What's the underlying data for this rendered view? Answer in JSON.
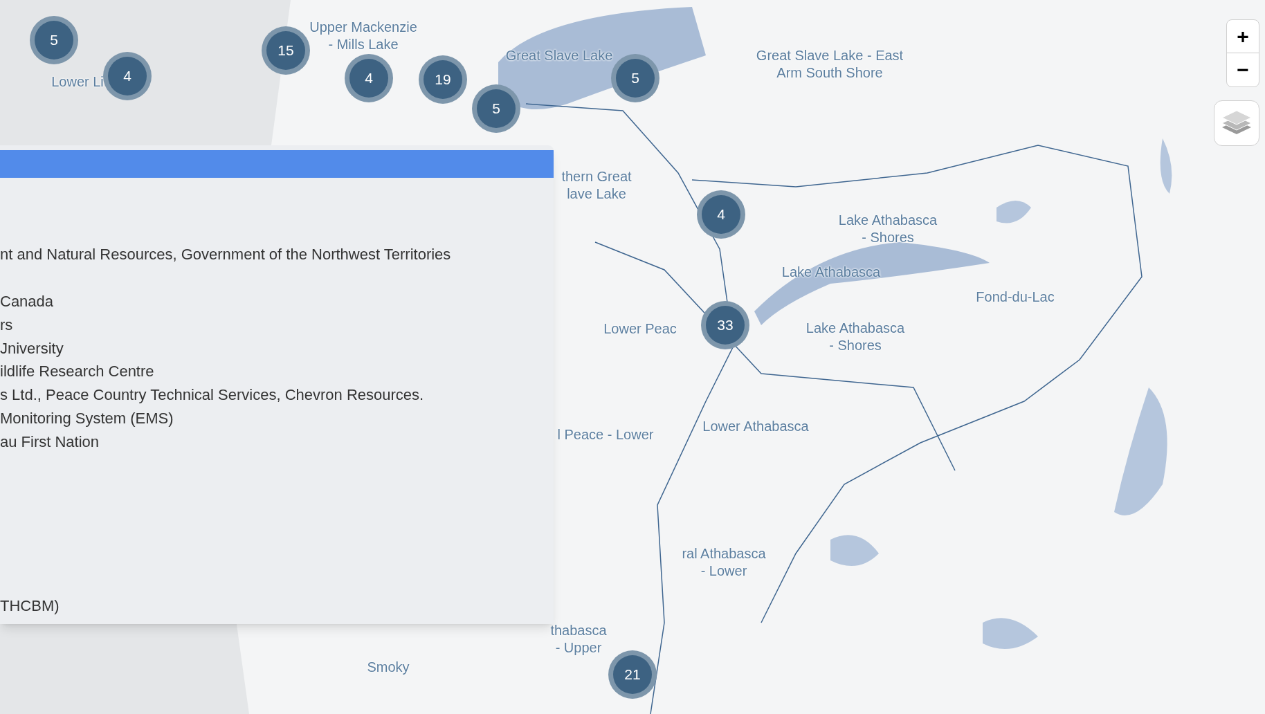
{
  "map": {
    "region_labels": [
      {
        "lines": [
          "Upper Mackenzie",
          "- Mills Lake"
        ]
      },
      {
        "lines": [
          "Lower Li"
        ]
      },
      {
        "lines": [
          "Great Slave Lake"
        ]
      },
      {
        "lines": [
          "Great Slave Lake - East",
          "Arm South Shore"
        ]
      },
      {
        "lines": [
          "thern Great",
          "lave Lake"
        ]
      },
      {
        "lines": [
          "Lake Athabasca",
          "- Shores"
        ]
      },
      {
        "lines": [
          "Lake Athabasca"
        ]
      },
      {
        "lines": [
          "Fond-du-Lac"
        ]
      },
      {
        "lines": [
          "Lower Peac"
        ]
      },
      {
        "lines": [
          "Lake Athabasca",
          "- Shores"
        ]
      },
      {
        "lines": [
          "l Peace - Lower"
        ]
      },
      {
        "lines": [
          "Lower Athabasca"
        ]
      },
      {
        "lines": [
          "ral Athabasca",
          "- Lower"
        ]
      },
      {
        "lines": [
          "thabasca",
          "- Upper"
        ]
      },
      {
        "lines": [
          "Smoky"
        ]
      }
    ],
    "clusters": [
      {
        "count": "5"
      },
      {
        "count": "4"
      },
      {
        "count": "15"
      },
      {
        "count": "4"
      },
      {
        "count": "19"
      },
      {
        "count": "5"
      },
      {
        "count": "5"
      },
      {
        "count": "4"
      },
      {
        "count": "33"
      },
      {
        "count": "21"
      }
    ],
    "zoom_controls": [
      "+",
      "−"
    ]
  },
  "panel": {
    "lines": [
      {
        "text": "nt and Natural Resources, Government of the Northwest Territories"
      },
      {
        "text": "Canada"
      },
      {
        "text": "rs"
      },
      {
        "text": "Jniversity"
      },
      {
        "text": "ildlife Research Centre"
      },
      {
        "text": "s Ltd., Peace Country Technical Services, Chevron Resources."
      },
      {
        "text": "Monitoring System (EMS)"
      },
      {
        "text": "au First Nation"
      },
      {
        "text": "THCBM)"
      }
    ]
  }
}
